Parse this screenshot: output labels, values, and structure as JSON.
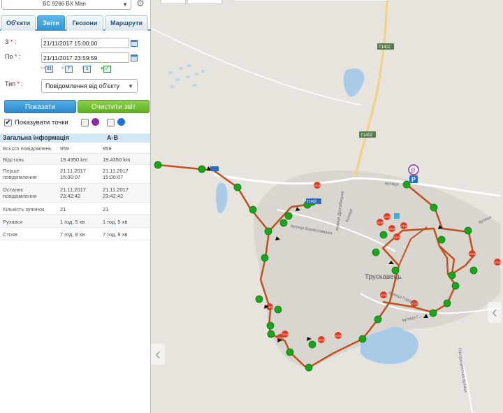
{
  "vehicle": {
    "value": "BC 9266 BX Man"
  },
  "icons": {
    "settings": "gear-icon",
    "calendar": "calendar-icon",
    "dropdown": "chevron-down-icon"
  },
  "tabs": [
    {
      "label": "Об'єкти",
      "active": false
    },
    {
      "label": "Звіти",
      "active": true
    },
    {
      "label": "Геозони",
      "active": false
    },
    {
      "label": "Маршрути",
      "active": false
    }
  ],
  "form": {
    "from_label": "З",
    "from_value": "21/11/2017 15:00:00",
    "to_label": "По",
    "to_value": "21/11/2017 23:59:59",
    "quick_ranges": [
      "01",
      "7",
      "1"
    ],
    "type_label": "Тип",
    "type_value": "Повідомлення від об'єкту"
  },
  "buttons": {
    "show": "Показати",
    "clear": "Очистити звіт"
  },
  "show_points": {
    "label": "Показувати точки",
    "checked": true,
    "color_a": "#8e2aa8",
    "color_b": "#1e6fd6"
  },
  "summary": {
    "header": [
      "Загальна інформація",
      "A-B"
    ],
    "rows": [
      {
        "label": "Всього повідомлень",
        "value": "959",
        "ab": "959"
      },
      {
        "label": "Відстань",
        "value": "19.4350 km",
        "ab": "19.4350 km"
      },
      {
        "label": "Перше повідомлення",
        "value": "21.11.2017 15:00:07",
        "ab": "21.11.2017 15:00:07"
      },
      {
        "label": "Останнє повідомлення",
        "value": "21.11.2017 23:42:42",
        "ab": "21.11.2017 23:42:42"
      },
      {
        "label": "Кількість зупинок",
        "value": "21",
        "ab": "21"
      },
      {
        "label": "Рухався",
        "value": "1 год, 5 хв",
        "ab": "1 год, 5 хв"
      },
      {
        "label": "Стояв",
        "value": "7 год, 8 хв",
        "ab": "7 год, 8 хв"
      }
    ]
  },
  "map": {
    "city_label": "Трускавець",
    "road_labels": [
      "T1402",
      "T1402",
      "T1402"
    ],
    "street_labels": [
      "вулиця Бориславська",
      "вулиця Дрогобицька",
      "вулиця Городищ...",
      "вулиця Г...",
      "вулиця",
      "вулиця",
      "вулиця",
      "Городищенська вулиця"
    ],
    "marker_b": "B",
    "marker_p": "P",
    "stop_label": "STOP",
    "colors": {
      "route": "#c0501c",
      "point": "#1aa51a",
      "stop": "#e03a1e",
      "water": "#a9cbe8"
    }
  }
}
